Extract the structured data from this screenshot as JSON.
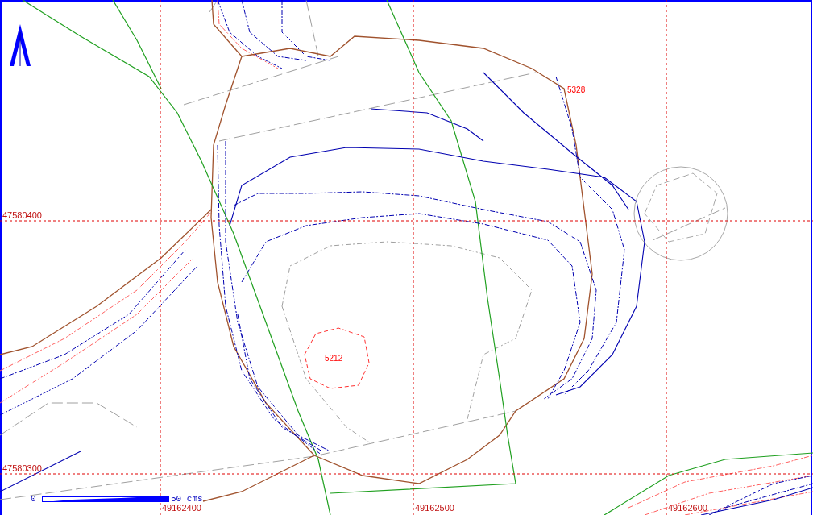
{
  "grid": {
    "y_labels": [
      "47580400",
      "47580300"
    ],
    "x_labels": [
      "49162400",
      "49162500",
      "49162600"
    ]
  },
  "contour_labels": [
    "5328",
    "5212"
  ],
  "scale_bar": {
    "start": "0",
    "end": "50 cms"
  }
}
